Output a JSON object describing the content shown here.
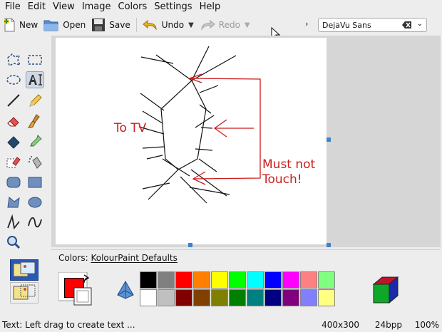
{
  "menu": [
    "File",
    "Edit",
    "View",
    "Image",
    "Colors",
    "Settings",
    "Help"
  ],
  "toolbar": {
    "new_label": "New",
    "open_label": "Open",
    "save_label": "Save",
    "undo_label": "Undo",
    "redo_label": "Redo",
    "font_name": "DejaVu Sans"
  },
  "drawing": {
    "text_left": "To TV",
    "text_right_line1": "Must not",
    "text_right_line2": "Touch!"
  },
  "colors_panel": {
    "title_prefix": "Colors: ",
    "palette_name": "KolourPaint Defaults",
    "foreground": "#ff0000",
    "background": "#ffffff",
    "palette_row1": [
      "#000000",
      "#808080",
      "#ff0000",
      "#ff8000",
      "#ffff00",
      "#00ff00",
      "#00ffff",
      "#0000ff",
      "#ff00ff",
      "#ff8080",
      "#80ff80"
    ],
    "palette_row2": [
      "#ffffff",
      "#c0c0c0",
      "#800000",
      "#804000",
      "#808000",
      "#008000",
      "#008080",
      "#000080",
      "#800080",
      "#8080ff",
      "#ffff80"
    ]
  },
  "status": {
    "message": "Text: Left drag to create text ...",
    "image_size": "400x300",
    "depth": "24bpp",
    "zoom": "100%"
  }
}
